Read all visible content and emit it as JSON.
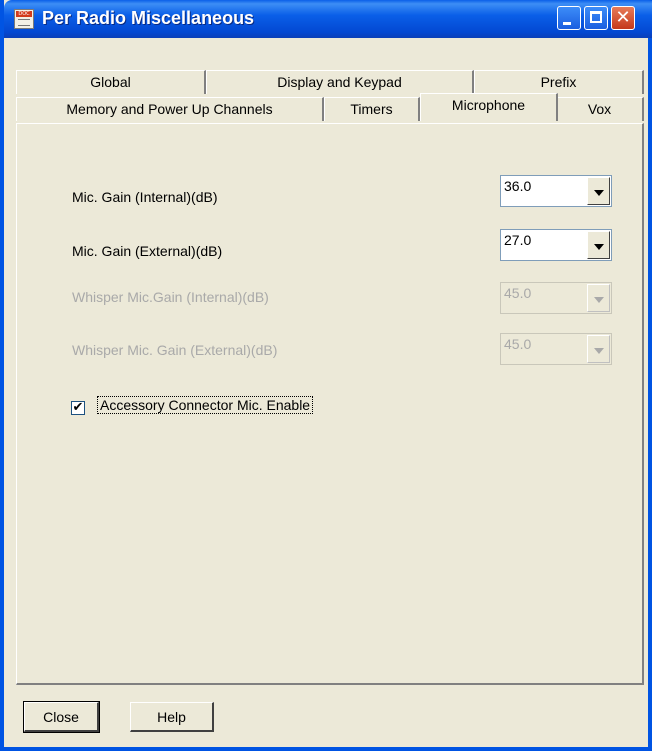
{
  "window": {
    "title": "Per Radio Miscellaneous"
  },
  "icons": {
    "app": "document-icon",
    "minimize": "minimize-icon",
    "maximize": "maximize-icon",
    "close": "close-icon",
    "dropdown": "chevron-down-icon"
  },
  "tabs": {
    "row1": [
      "Global",
      "Display and Keypad",
      "Prefix"
    ],
    "row2": [
      "Memory and Power Up Channels",
      "Timers",
      "Microphone",
      "Vox"
    ],
    "active": "Microphone"
  },
  "microphone": {
    "fields": [
      {
        "label": "Mic. Gain (Internal)(dB)",
        "value": "36.0",
        "enabled": true
      },
      {
        "label": "Mic. Gain (External)(dB)",
        "value": "27.0",
        "enabled": true
      },
      {
        "label": "Whisper Mic.Gain (Internal)(dB)",
        "value": "45.0",
        "enabled": false
      },
      {
        "label": "Whisper Mic. Gain (External)(dB)",
        "value": "45.0",
        "enabled": false
      }
    ],
    "accessory": {
      "label": "Accessory Connector Mic. Enable",
      "checked": true,
      "mark": "✔"
    }
  },
  "buttons": {
    "close": "Close",
    "help": "Help"
  }
}
